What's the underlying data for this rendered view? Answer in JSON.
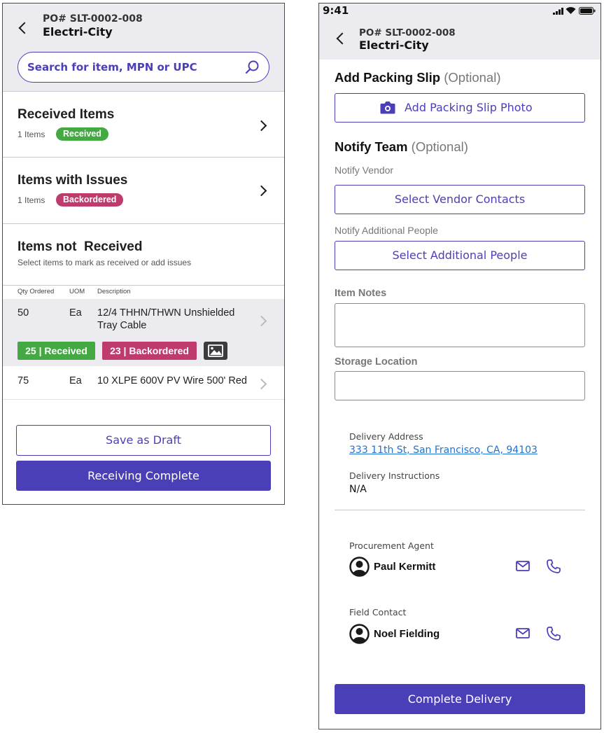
{
  "colors": {
    "accent": "#4b3fb8",
    "received": "#44a843",
    "backordered": "#bf3b6e",
    "header_bg": "#ececf0",
    "link": "#1d73d6"
  },
  "left": {
    "header": {
      "po": "PO# SLT-0002-008",
      "vendor": "Electri-City"
    },
    "search": {
      "placeholder": "Search for item, MPN or UPC"
    },
    "received": {
      "title": "Received Items",
      "count": "1 Items",
      "badge": "Received"
    },
    "issues": {
      "title": "Items with Issues",
      "count": "1 Items",
      "badge": "Backordered"
    },
    "not_received": {
      "title": "Items not  Received",
      "subtitle": "Select items to mark as received or add issues"
    },
    "table": {
      "headers": [
        "Qty Ordered",
        "UOM",
        "Description"
      ],
      "rows": [
        {
          "qty": "50",
          "uom": "Ea",
          "desc1": "12/4 THHN/THWN Unshielded",
          "desc2": "Tray Cable",
          "received_tag": "25 | Received",
          "backordered_tag": "23 | Backordered"
        },
        {
          "qty": "75",
          "uom": "Ea",
          "desc1": "10 XLPE 600V PV Wire 500' Red"
        }
      ]
    },
    "buttons": {
      "draft": "Save as Draft",
      "complete": "Receiving Complete"
    }
  },
  "right": {
    "status": {
      "time": "9:41"
    },
    "header": {
      "po": "PO# SLT-0002-008",
      "vendor": "Electri-City"
    },
    "packing": {
      "title": "Add Packing Slip",
      "optional": "(Optional)",
      "button": "Add Packing Slip Photo"
    },
    "notify": {
      "title": "Notify Team",
      "optional": "(Optional)",
      "vendor_label": "Notify Vendor",
      "vendor_button": "Select Vendor Contacts",
      "people_label": "Notify Additional People",
      "people_button": "Select Additional People"
    },
    "item_notes_label": "Item Notes",
    "storage_label": "Storage Location",
    "delivery": {
      "address_label": "Delivery Address",
      "address": "333 11th St, San Francisco, CA, 94103",
      "instructions_label": "Delivery Instructions",
      "instructions": "N/A"
    },
    "agent": {
      "label": "Procurement Agent",
      "name": "Paul Kermitt"
    },
    "field_contact": {
      "label": "Field Contact",
      "name": "Noel Fielding"
    },
    "complete_button": "Complete Delivery"
  }
}
